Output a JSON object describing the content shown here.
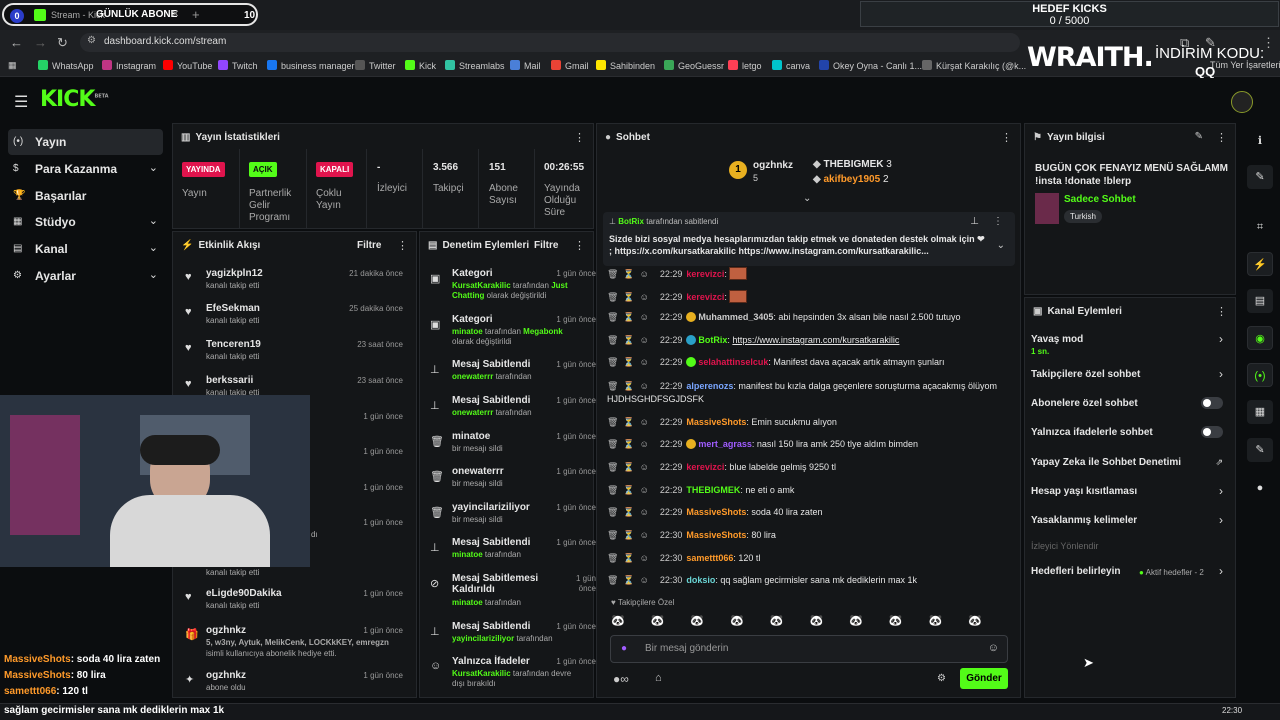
{
  "browser": {
    "tab_count": "0",
    "tab_title": "Stream - Kick",
    "tab_overlay": "GÜNLÜK ABONE",
    "tab_number": "10",
    "url": "dashboard.kick.com/stream",
    "goal_title": "HEDEF KICKS",
    "goal_value": "0 / 5000",
    "bookmarks": [
      "WhatsApp",
      "Instagram",
      "YouTube",
      "Twitch",
      "business manager",
      "Twitter",
      "Kick",
      "Streamlabs",
      "Mail",
      "Gmail",
      "Sahibinden",
      "GeoGuessr",
      "letgo",
      "canva",
      "Okey Oyna - Canlı 1...",
      "Kürşat Karakılıç (@k...",
      "Tüm Yer İşaretleri"
    ],
    "promo_logo": "WRAITH.",
    "promo_text": "İNDİRİM KODU:",
    "promo_code": "QQ"
  },
  "nav": {
    "items": [
      {
        "label": "Yayın",
        "icon": "(•)"
      },
      {
        "label": "Para Kazanma",
        "icon": "$"
      },
      {
        "label": "Başarılar",
        "icon": "🏆"
      },
      {
        "label": "Stüdyo",
        "icon": "▦"
      },
      {
        "label": "Kanal",
        "icon": "▤"
      },
      {
        "label": "Ayarlar",
        "icon": "⚙"
      }
    ]
  },
  "stats": {
    "title": "Yayın İstatistikleri",
    "live_badge": "YAYINDA",
    "live_label": "Yayın",
    "partner_badge": "AÇIK",
    "partner_label": "Partnerlik Gelir Programı",
    "multi_badge": "KAPALI",
    "multi_label": "Çoklu Yayın",
    "viewers_value": "-",
    "viewers_label": "İzleyici",
    "followers_value": "3.566",
    "followers_label": "Takipçi",
    "subs_value": "151",
    "subs_label": "Abone Sayısı",
    "uptime_value": "00:26:55",
    "uptime_label": "Yayında Olduğu Süre"
  },
  "activity": {
    "title": "Etkinlik Akışı",
    "filter": "Filtre",
    "items": [
      {
        "name": "yagizkpln12",
        "sub": "kanalı takip etti",
        "time": "21 dakika önce"
      },
      {
        "name": "EfeSekman",
        "sub": "kanalı takip etti",
        "time": "25 dakika önce"
      },
      {
        "name": "Tenceren19",
        "sub": "kanalı takip etti",
        "time": "23 saat önce"
      },
      {
        "name": "berkssarii",
        "sub": "kanalı takip etti",
        "time": "23 saat önce"
      },
      {
        "name": "",
        "sub": "",
        "time": "1 gün önce"
      },
      {
        "name": "",
        "sub": "",
        "time": "1 gün önce"
      },
      {
        "name": "",
        "sub": "",
        "time": "1 gün önce"
      },
      {
        "name": "",
        "sub": "dı",
        "time": "1 gün önce"
      },
      {
        "name": "",
        "sub": "kanalı takip etti",
        "time": ""
      },
      {
        "name": "eLigde90Dakika",
        "sub": "kanalı takip etti",
        "time": "1 gün önce"
      },
      {
        "name": "ogzhnkz",
        "sub": "isimli kullanıcıya abonelik hediye etti.",
        "sub_green": "5, w3ny, Aytuk, MelikCenk, LOCKkKEY, emregzn",
        "time": "1 gün önce"
      },
      {
        "name": "ogzhnkz",
        "sub": "abone oldu",
        "time": "1 gün önce"
      }
    ]
  },
  "moderation": {
    "title": "Denetim Eylemleri",
    "filter": "Filtre",
    "items": [
      {
        "name": "Kategori",
        "l1g": "KursatKarakilic",
        "l1": " tarafından ",
        "l1g2": "Just Chatting",
        "l2": " olarak değiştirildi",
        "time": "1 gün önce"
      },
      {
        "name": "Kategori",
        "l1g": "minatoe",
        "l1": " tarafından ",
        "l1g2": "Megabonk",
        "l2": " olarak değiştirildi",
        "time": "1 gün önce"
      },
      {
        "name": "Mesaj Sabitlendi",
        "l1g": "onewaterrr",
        "l1": " tarafından",
        "time": "1 gün önce"
      },
      {
        "name": "Mesaj Sabitlendi",
        "l1g": "onewaterrr",
        "l1": " tarafından",
        "time": "1 gün önce"
      },
      {
        "name": "minatoe",
        "l1": "bir mesajı sildi",
        "time": "1 gün önce"
      },
      {
        "name": "onewaterrr",
        "l1": "bir mesajı sildi",
        "time": "1 gün önce"
      },
      {
        "name": "yayincilariziliyor",
        "l1": "bir mesajı sildi",
        "time": "1 gün önce"
      },
      {
        "name": "Mesaj Sabitlendi",
        "l1g": "minatoe",
        "l1": " tarafından",
        "time": "1 gün önce"
      },
      {
        "name": "Mesaj Sabitlemesi Kaldırıldı",
        "l1g": "minatoe",
        "l1": " tarafından",
        "time": "1 gün önce"
      },
      {
        "name": "Mesaj Sabitlendi",
        "l1g": "yayincilariziliyor",
        "l1": " tarafından",
        "time": "1 gün önce"
      },
      {
        "name": "Yalnızca İfadeler",
        "l1g": "KursatKarakilic",
        "l1": " tarafından devre dışı bırakıldı",
        "time": "1 gün önce"
      }
    ]
  },
  "chat": {
    "title": "Sohbet",
    "leaders": [
      {
        "name": "ogzhnkz",
        "count": "5",
        "rank": "1"
      },
      {
        "name": "THEBIGMEK",
        "count": "3"
      },
      {
        "name": "akifbey1905",
        "count": "2"
      }
    ],
    "pinned_by": "BotRix",
    "pinned_suffix": "tarafından sabitlendi",
    "pinned_text": "Sizde bizi sosyal medya hesaplarımızdan takip etmek ve donateden destek olmak için ❤ ; https://x.com/kursatkarakilic https://www.instagram.com/kursatkarakilic...",
    "messages": [
      {
        "time": "22:29",
        "user": "kerevizci",
        "color": "#e0144d",
        "text": "",
        "emote": true
      },
      {
        "time": "22:29",
        "user": "kerevizci",
        "color": "#e0144d",
        "text": "",
        "emote": true
      },
      {
        "time": "22:29",
        "user": "Muhammed_3405",
        "color": "#cccccc",
        "text": "abi hepsinden 3x alsan bile nasıl 2.500 tutuyo"
      },
      {
        "time": "22:29",
        "user": "BotRix",
        "color": "#53fc18",
        "text": "https://www.instagram.com/kursatkarakilic"
      },
      {
        "time": "22:29",
        "user": "selahattinselcuk",
        "color": "#e0144d",
        "text": "Manifest dava açacak artık atmayın şunları"
      },
      {
        "time": "22:29",
        "user": "alperenozs",
        "color": "#7aa6ff",
        "text": "manifest bu kızla dalga geçenlere soruşturma açacakmış ölüyom HJDHSGHDFSGJDSFK"
      },
      {
        "time": "22:29",
        "user": "MassiveShots",
        "color": "#ff9a2a",
        "text": "Emin sucukmu alıyon"
      },
      {
        "time": "22:29",
        "user": "mert_agrass",
        "color": "#a05cff",
        "text": "nasıl 150 lira amk 250 tlye aldım bimden"
      },
      {
        "time": "22:29",
        "user": "kerevizci",
        "color": "#e0144d",
        "text": "blue labelde gelmiş 9250 tl"
      },
      {
        "time": "22:29",
        "user": "THEBIGMEK",
        "color": "#53fc18",
        "text": "ne eti o amk"
      },
      {
        "time": "22:29",
        "user": "MassiveShots",
        "color": "#ff9a2a",
        "text": "soda 40 lira zaten"
      },
      {
        "time": "22:30",
        "user": "MassiveShots",
        "color": "#ff9a2a",
        "text": "80 lira"
      },
      {
        "time": "22:30",
        "user": "samettt066",
        "color": "#ff9a2a",
        "text": "120 tl"
      },
      {
        "time": "22:30",
        "user": "doksio",
        "color": "#6ad4d4",
        "text": "qq sağlam gecirmisler sana mk dediklerin max 1k"
      }
    ],
    "follower_label": "Takipçilere Özel",
    "input_placeholder": "Bir mesaj gönderin",
    "send_label": "Gönder"
  },
  "stream_info": {
    "title": "Yayın bilgisi",
    "stream_title": "BUGÜN ÇOK FENAYIZ MENÜ SAĞLAMM !insta !donate !blerp",
    "category": "Sadece Sohbet",
    "language": "Turkish"
  },
  "channel_actions": {
    "title": "Kanal Eylemleri",
    "slow_mode": "Yavaş mod",
    "slow_mode_value": "1 sn.",
    "items": [
      "Takipçilere özel sohbet",
      "Abonelere özel sohbet",
      "Yalnızca ifadelerle sohbet",
      "Yapay Zeka ile Sohbet Denetimi",
      "Hesap yaşı kısıtlaması",
      "Yasaklanmış kelimeler"
    ],
    "viewer_redirect": "İzleyici Yönlendir",
    "goals": "Hedefleri belirleyin",
    "goals_status": "Aktif hedefler - 2"
  },
  "overlay_chat": [
    {
      "user": "MassiveShots",
      "text": ": soda 40 lira zaten"
    },
    {
      "user": "MassiveShots",
      "text": ": 80 lira"
    },
    {
      "user": "samettt066",
      "text": ": 120 tl"
    }
  ],
  "bottom_text": "sağlam gecirmisler sana mk dediklerin max 1k",
  "clock": "22:30",
  "colors": {
    "accent": "#53fc18",
    "live": "#e0144d",
    "panel": "#141618",
    "bg": "#0b0d0f"
  }
}
